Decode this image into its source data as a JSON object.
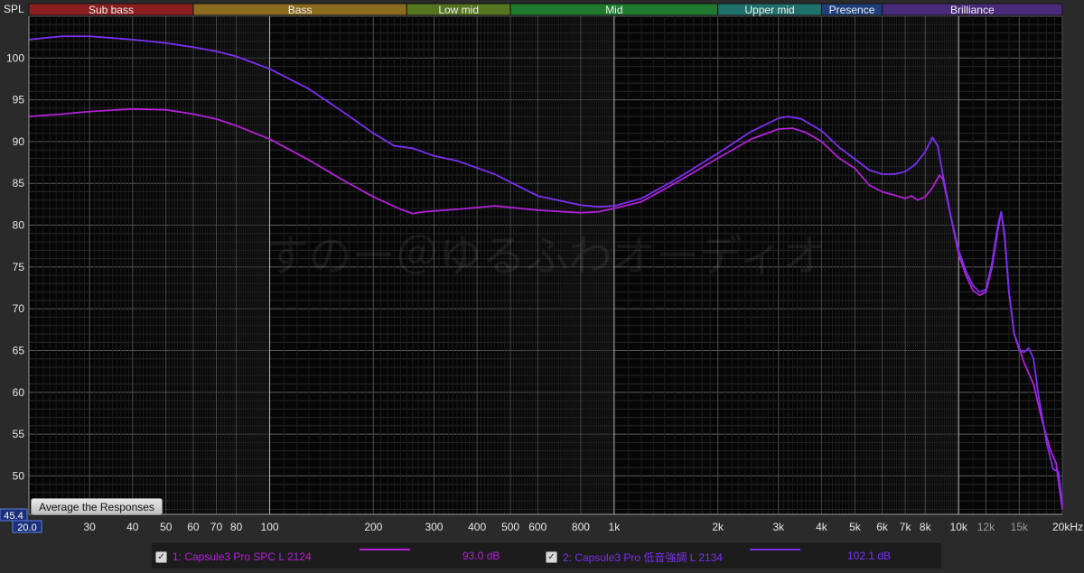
{
  "chart_data": {
    "type": "line",
    "title": "",
    "xlabel": "",
    "ylabel": "SPL",
    "x_scale": "log",
    "xlim": [
      20,
      20000
    ],
    "ylim": [
      45.4,
      105
    ],
    "grid": true,
    "legend_placement": "bottom",
    "watermark": "すのー＠ゆるふわオーディオ",
    "y_min_label": "45.4",
    "x_min_label": "20.0",
    "y_ticks": [
      {
        "value": 50,
        "label": "50"
      },
      {
        "value": 55,
        "label": "55"
      },
      {
        "value": 60,
        "label": "60"
      },
      {
        "value": 65,
        "label": "65"
      },
      {
        "value": 70,
        "label": "70"
      },
      {
        "value": 75,
        "label": "75"
      },
      {
        "value": 80,
        "label": "80"
      },
      {
        "value": 85,
        "label": "85"
      },
      {
        "value": 90,
        "label": "90"
      },
      {
        "value": 95,
        "label": "95"
      },
      {
        "value": 100,
        "label": "100"
      }
    ],
    "x_ticks": [
      {
        "value": 30,
        "label": "30"
      },
      {
        "value": 40,
        "label": "40"
      },
      {
        "value": 50,
        "label": "50"
      },
      {
        "value": 60,
        "label": "60"
      },
      {
        "value": 70,
        "label": "70"
      },
      {
        "value": 80,
        "label": "80"
      },
      {
        "value": 100,
        "label": "100"
      },
      {
        "value": 200,
        "label": "200"
      },
      {
        "value": 300,
        "label": "300"
      },
      {
        "value": 400,
        "label": "400"
      },
      {
        "value": 500,
        "label": "500"
      },
      {
        "value": 600,
        "label": "600"
      },
      {
        "value": 800,
        "label": "800"
      },
      {
        "value": 1000,
        "label": "1k"
      },
      {
        "value": 2000,
        "label": "2k"
      },
      {
        "value": 3000,
        "label": "3k"
      },
      {
        "value": 4000,
        "label": "4k"
      },
      {
        "value": 5000,
        "label": "5k"
      },
      {
        "value": 6000,
        "label": "6k"
      },
      {
        "value": 7000,
        "label": "7k"
      },
      {
        "value": 8000,
        "label": "8k"
      },
      {
        "value": 10000,
        "label": "10k"
      },
      {
        "value": 12000,
        "label": "12k"
      },
      {
        "value": 15000,
        "label": "15k"
      },
      {
        "value": 20000,
        "label": "20kHz"
      }
    ],
    "bands": [
      {
        "label": "Sub bass",
        "from": 20,
        "to": 60,
        "color": "#8a1f1f"
      },
      {
        "label": "Bass",
        "from": 60,
        "to": 250,
        "color": "#8a6a1c"
      },
      {
        "label": "Low mid",
        "from": 250,
        "to": 500,
        "color": "#55751f"
      },
      {
        "label": "Mid",
        "from": 500,
        "to": 2000,
        "color": "#1f7a2f"
      },
      {
        "label": "Upper mid",
        "from": 2000,
        "to": 4000,
        "color": "#1f6f6a"
      },
      {
        "label": "Presence",
        "from": 4000,
        "to": 6000,
        "color": "#1f3f7a"
      },
      {
        "label": "Brilliance",
        "from": 6000,
        "to": 20000,
        "color": "#4a2a7a"
      }
    ],
    "series": [
      {
        "name": "1: Capsule3 Pro SPC L 2124",
        "level": "93.0 dB",
        "color": "#b320d8",
        "points": [
          [
            20,
            93
          ],
          [
            25,
            93.3
          ],
          [
            30,
            93.6
          ],
          [
            40,
            93.9
          ],
          [
            50,
            93.8
          ],
          [
            60,
            93.3
          ],
          [
            70,
            92.7
          ],
          [
            80,
            91.9
          ],
          [
            100,
            90.3
          ],
          [
            130,
            87.8
          ],
          [
            160,
            85.6
          ],
          [
            200,
            83.4
          ],
          [
            240,
            81.9
          ],
          [
            260,
            81.4
          ],
          [
            280,
            81.6
          ],
          [
            350,
            81.9
          ],
          [
            450,
            82.3
          ],
          [
            600,
            81.8
          ],
          [
            800,
            81.5
          ],
          [
            900,
            81.6
          ],
          [
            1000,
            82.0
          ],
          [
            1200,
            82.8
          ],
          [
            1500,
            85.0
          ],
          [
            2000,
            88.0
          ],
          [
            2500,
            90.3
          ],
          [
            3000,
            91.5
          ],
          [
            3300,
            91.6
          ],
          [
            3600,
            91.1
          ],
          [
            4000,
            90.0
          ],
          [
            4500,
            88.0
          ],
          [
            5000,
            86.8
          ],
          [
            5500,
            84.8
          ],
          [
            6000,
            84.0
          ],
          [
            6500,
            83.6
          ],
          [
            7000,
            83.2
          ],
          [
            7300,
            83.5
          ],
          [
            7600,
            83.0
          ],
          [
            8000,
            83.4
          ],
          [
            8400,
            84.5
          ],
          [
            8800,
            86.0
          ],
          [
            9000,
            85.5
          ],
          [
            9500,
            81.0
          ],
          [
            10000,
            76.5
          ],
          [
            10500,
            74.0
          ],
          [
            11000,
            72.2
          ],
          [
            11500,
            71.6
          ],
          [
            12000,
            72.0
          ],
          [
            12500,
            75.0
          ],
          [
            13000,
            79.5
          ],
          [
            13300,
            81.5
          ],
          [
            13600,
            79.0
          ],
          [
            14000,
            72.0
          ],
          [
            14500,
            67.0
          ],
          [
            15000,
            65.3
          ],
          [
            15500,
            63.5
          ],
          [
            16500,
            61.0
          ],
          [
            17500,
            56.5
          ],
          [
            18500,
            53.0
          ],
          [
            19200,
            51.5
          ],
          [
            19600,
            48.5
          ],
          [
            20000,
            46.0
          ]
        ]
      },
      {
        "name": "2: Capsule3 Pro 低音強調 L 2134",
        "level": "102.1 dB",
        "color": "#7b2ff0",
        "points": [
          [
            20,
            102.2
          ],
          [
            25,
            102.6
          ],
          [
            30,
            102.6
          ],
          [
            40,
            102.2
          ],
          [
            50,
            101.8
          ],
          [
            60,
            101.3
          ],
          [
            70,
            100.8
          ],
          [
            80,
            100.2
          ],
          [
            100,
            98.7
          ],
          [
            130,
            96.3
          ],
          [
            160,
            93.8
          ],
          [
            200,
            91.0
          ],
          [
            230,
            89.5
          ],
          [
            260,
            89.2
          ],
          [
            300,
            88.3
          ],
          [
            350,
            87.7
          ],
          [
            450,
            86.1
          ],
          [
            600,
            83.5
          ],
          [
            800,
            82.4
          ],
          [
            900,
            82.2
          ],
          [
            1000,
            82.3
          ],
          [
            1200,
            83.2
          ],
          [
            1500,
            85.4
          ],
          [
            2000,
            88.6
          ],
          [
            2500,
            91.2
          ],
          [
            3000,
            92.8
          ],
          [
            3200,
            93.0
          ],
          [
            3500,
            92.7
          ],
          [
            4000,
            91.3
          ],
          [
            4500,
            89.3
          ],
          [
            5000,
            87.9
          ],
          [
            5500,
            86.6
          ],
          [
            6000,
            86.1
          ],
          [
            6500,
            86.1
          ],
          [
            7000,
            86.4
          ],
          [
            7500,
            87.3
          ],
          [
            8000,
            88.8
          ],
          [
            8400,
            90.5
          ],
          [
            8700,
            89.5
          ],
          [
            9000,
            86.0
          ],
          [
            9500,
            81.0
          ],
          [
            10000,
            77.0
          ],
          [
            10500,
            74.5
          ],
          [
            11000,
            72.8
          ],
          [
            11500,
            72.0
          ],
          [
            12000,
            72.3
          ],
          [
            12500,
            75.5
          ],
          [
            13000,
            80.0
          ],
          [
            13300,
            81.6
          ],
          [
            13600,
            78.5
          ],
          [
            14000,
            72.0
          ],
          [
            14500,
            67.0
          ],
          [
            15000,
            65.0
          ],
          [
            15500,
            64.8
          ],
          [
            16000,
            65.3
          ],
          [
            16500,
            64.0
          ],
          [
            17000,
            60.0
          ],
          [
            18000,
            54.0
          ],
          [
            18800,
            50.8
          ],
          [
            19500,
            50.5
          ],
          [
            20000,
            46.5
          ]
        ]
      }
    ]
  },
  "controls": {
    "average_button": "Average the Responses"
  }
}
